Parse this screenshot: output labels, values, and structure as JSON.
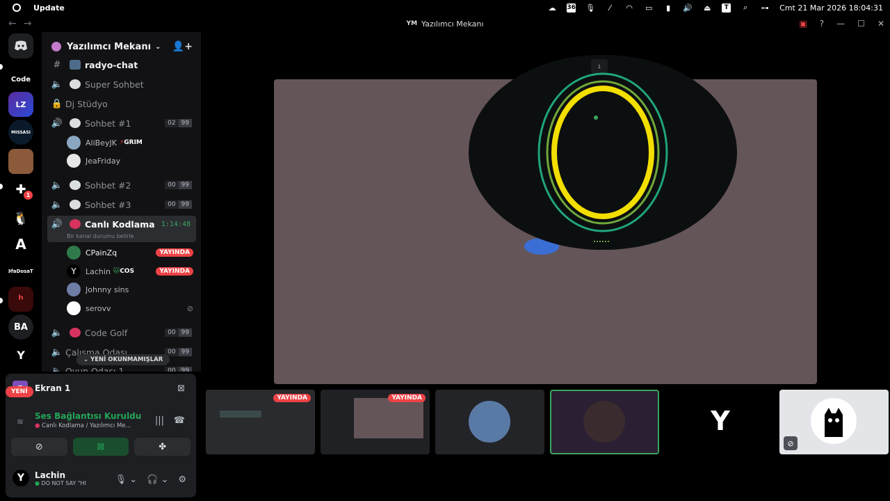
{
  "topbar": {
    "app": "Update",
    "datetime": "Cmt 21 Mar 2026 18:04:31",
    "tray_badge_1": "36",
    "tray_badge_2": "T"
  },
  "titlebar": {
    "title": "Yazılımcı Mekanı",
    "logo": "YM"
  },
  "servers": {
    "code_label": "Code",
    "misc_label": "MISSASI",
    "text_label": "ƏfaDosaTı",
    "ba_label": "BA",
    "notif_count": "1",
    "new_label": "YENİ"
  },
  "guild": {
    "name": "Yazılımcı Mekanı"
  },
  "channels": [
    {
      "name": "radyo-chat",
      "type": "text"
    },
    {
      "name": "Super Sohbet",
      "type": "voice"
    },
    {
      "name": "Dj Stüdyo",
      "type": "locked"
    },
    {
      "name": "Sohbet #1",
      "type": "voice",
      "counts": [
        "02",
        "99"
      ]
    },
    {
      "name": "Sohbet #2",
      "type": "voice",
      "counts": [
        "00",
        "99"
      ]
    },
    {
      "name": "Sohbet #3",
      "type": "voice",
      "counts": [
        "00",
        "99"
      ]
    },
    {
      "name": "Canlı Kodlama",
      "type": "voice",
      "timer": "1:14:48",
      "status": "Bir kanal durumu belirle"
    },
    {
      "name": "Code Golf",
      "type": "voice",
      "counts": [
        "00",
        "99"
      ]
    },
    {
      "name": "Çalışma Odası",
      "type": "voice",
      "counts": [
        "00",
        "99"
      ]
    },
    {
      "name": "Oyun Odası 1",
      "type": "voice",
      "counts": [
        "00",
        "99"
      ]
    }
  ],
  "sohbet1_users": [
    {
      "name": "AliBeyJK",
      "tag": "GRIM"
    },
    {
      "name": "JeaFriday"
    }
  ],
  "kodlama_users": [
    {
      "name": "CPainZq",
      "live": "YAYINDA"
    },
    {
      "name": "Lachin",
      "tag": "COS",
      "live": "YAYINDA"
    },
    {
      "name": "Johnny sins"
    },
    {
      "name": "serovv"
    }
  ],
  "unread_label": "YENİ OKUNMAMIŞLAR",
  "panel": {
    "screen_label": "Ekran 1",
    "screen_icon": "F",
    "connection": "Ses Bağlantısı Kuruldu",
    "connection_sub": "Canlı Kodlama / Yazılımcı Me...",
    "user_name": "Lachin",
    "user_status": "DO NOT SAY \"HI"
  },
  "overlay": {
    "label_top": "1"
  },
  "tiles": {
    "live_label": "YAYINDA"
  }
}
